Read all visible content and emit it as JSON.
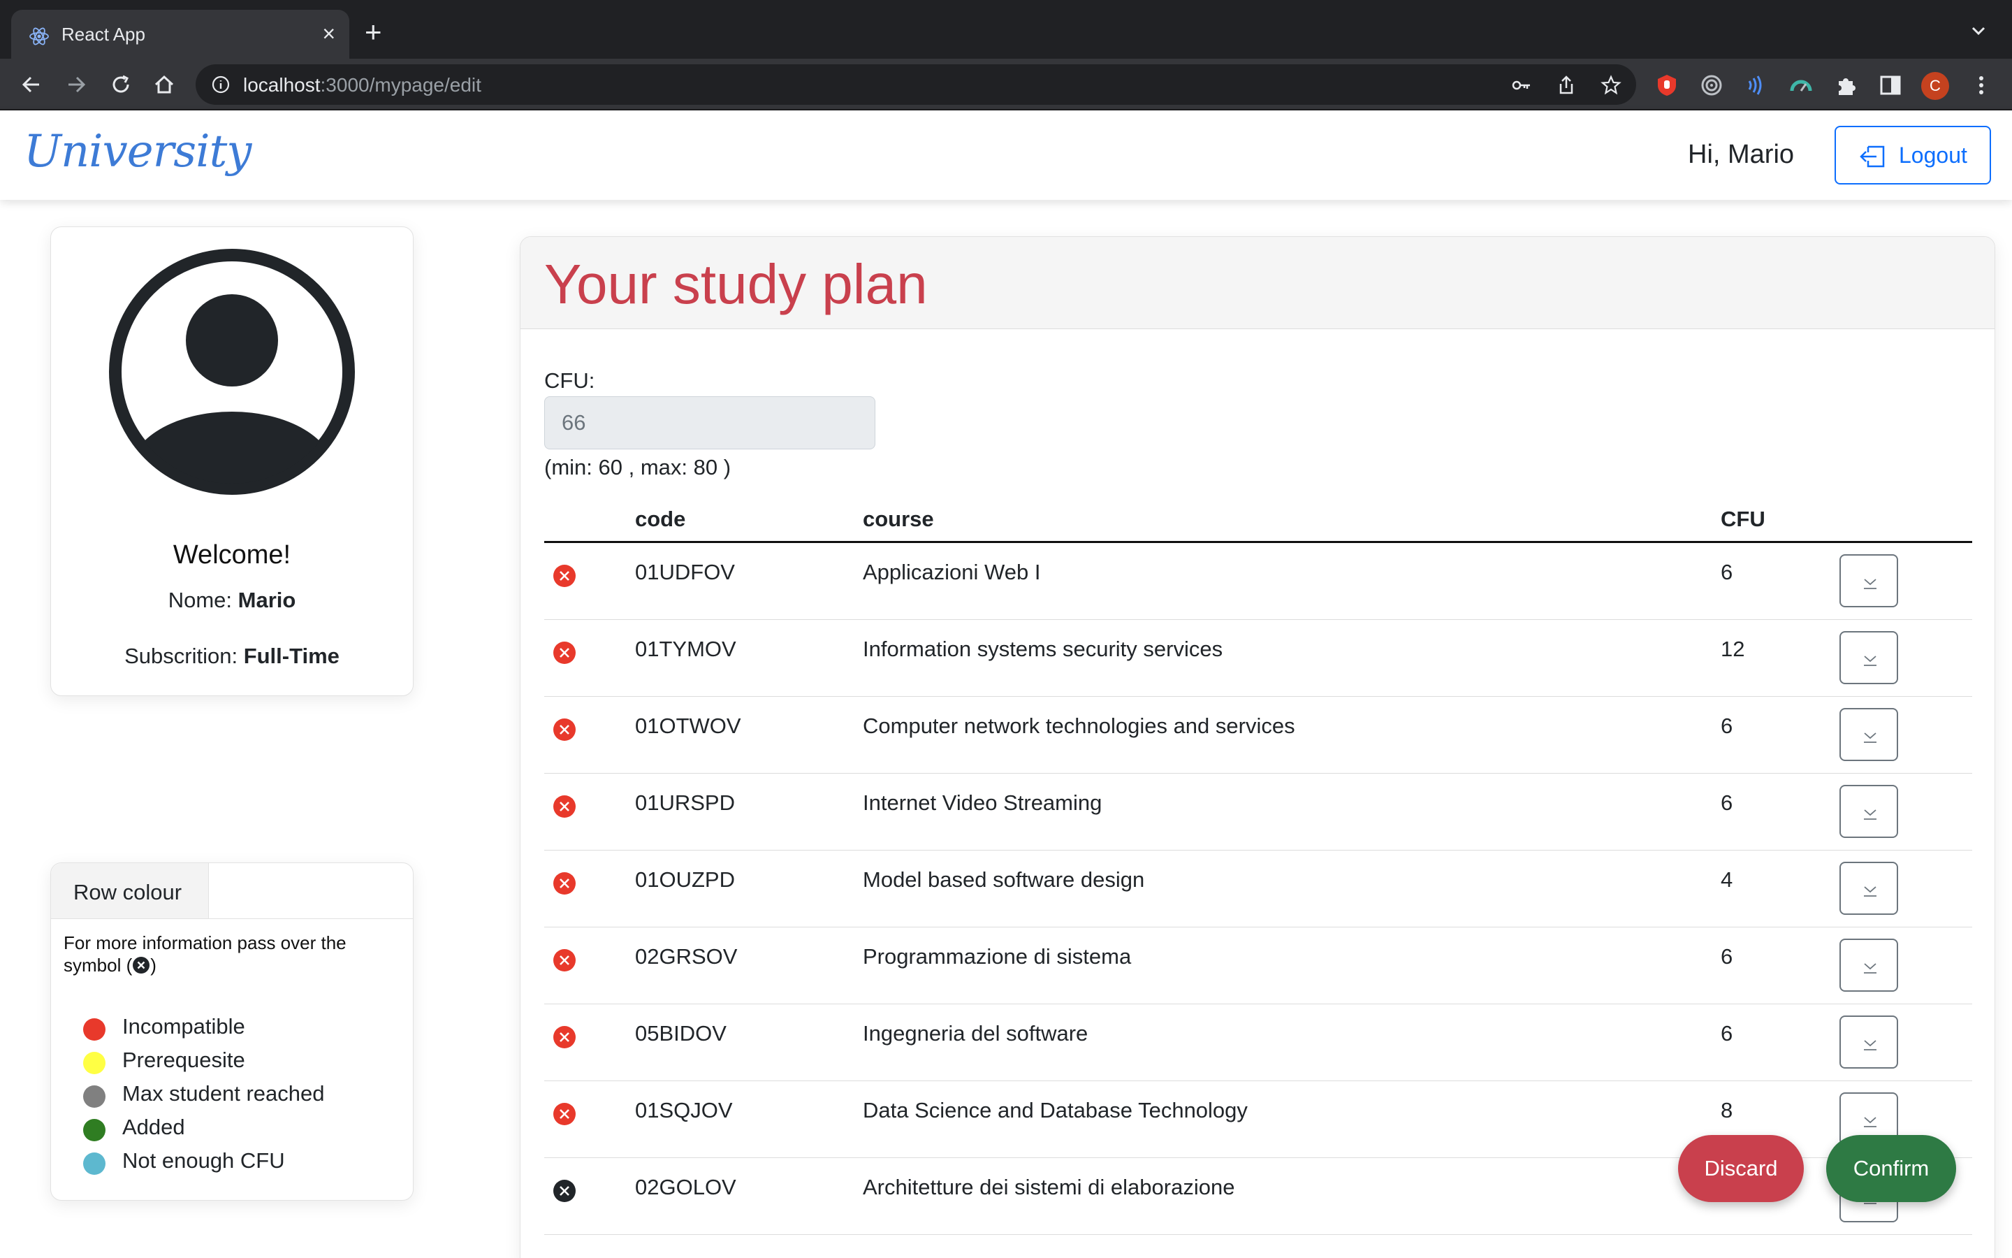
{
  "browser": {
    "tab_title": "React App",
    "tab_close": "×",
    "new_tab": "+",
    "url_host": "localhost",
    "url_path": ":3000/mypage/edit",
    "profile_initial": "C"
  },
  "navbar": {
    "brand": "University",
    "greeting": "Hi, Mario",
    "logout_label": "Logout"
  },
  "profile": {
    "welcome": "Welcome!",
    "nome_label": "Nome:",
    "nome_value": "Mario",
    "subscription_label": "Subscrition:",
    "subscription_value": "Full-Time"
  },
  "legend": {
    "tab_label": "Row colour",
    "info_prefix": "For more information pass over the symbol (",
    "info_suffix": ")",
    "items": [
      {
        "label": "Incompatible",
        "color": "#e8392b"
      },
      {
        "label": "Prerequesite",
        "color": "#ffff44"
      },
      {
        "label": "Max student reached",
        "color": "#808080"
      },
      {
        "label": "Added",
        "color": "#2f7d22"
      },
      {
        "label": "Not enough CFU",
        "color": "#5db8cf"
      }
    ]
  },
  "plan": {
    "title": "Your study plan",
    "cfu_label": "CFU:",
    "cfu_value": "66",
    "cfu_range": "(min: 60 , max: 80 )",
    "columns": {
      "code": "code",
      "course": "course",
      "cfu": "CFU"
    },
    "rows": [
      {
        "code": "01UDFOV",
        "course": "Applicazioni Web I",
        "cfu": "6",
        "status": "incompatible"
      },
      {
        "code": "01TYMOV",
        "course": "Information systems security services",
        "cfu": "12",
        "status": "incompatible"
      },
      {
        "code": "01OTWOV",
        "course": "Computer network technologies and services",
        "cfu": "6",
        "status": "incompatible"
      },
      {
        "code": "01URSPD",
        "course": "Internet Video Streaming",
        "cfu": "6",
        "status": "incompatible"
      },
      {
        "code": "01OUZPD",
        "course": "Model based software design",
        "cfu": "4",
        "status": "incompatible"
      },
      {
        "code": "02GRSOV",
        "course": "Programmazione di sistema",
        "cfu": "6",
        "status": "incompatible"
      },
      {
        "code": "05BIDOV",
        "course": "Ingegneria del software",
        "cfu": "6",
        "status": "incompatible"
      },
      {
        "code": "01SQJOV",
        "course": "Data Science and Database Technology",
        "cfu": "8",
        "status": "incompatible"
      },
      {
        "code": "02GOLOV",
        "course": "Architetture dei sistemi di elaborazione",
        "cfu": "",
        "status": "neutral"
      }
    ]
  },
  "actions": {
    "discard": "Discard",
    "confirm": "Confirm"
  },
  "colors": {
    "brand": "#3d7bd6",
    "title_red": "#c9404d",
    "primary": "#0d6efd",
    "discard": "#c9404d",
    "confirm": "#2e7a44",
    "incompatible_icon": "#e8392b",
    "neutral_icon": "#212529"
  }
}
